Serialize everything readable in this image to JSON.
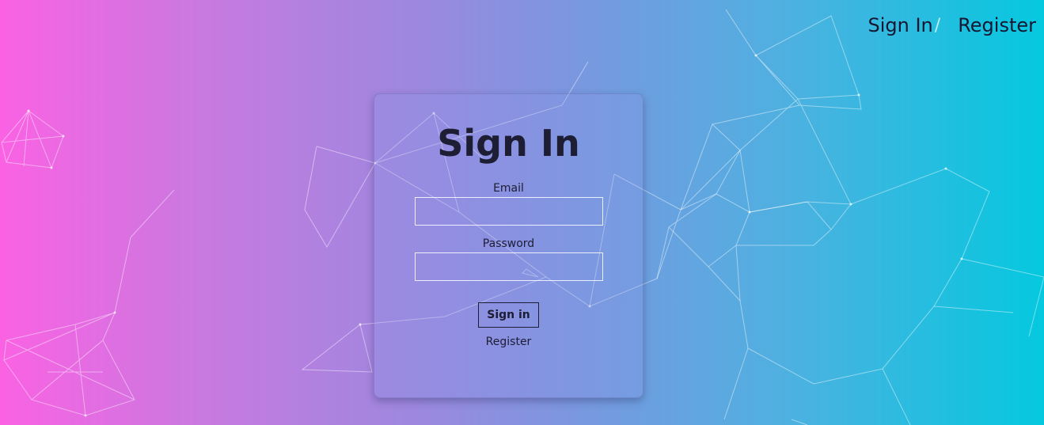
{
  "nav": {
    "sign_in": "Sign In",
    "separator": "/",
    "register": "Register"
  },
  "form": {
    "title": "Sign In",
    "email_label": "Email",
    "email_value": "",
    "password_label": "Password",
    "password_value": "",
    "submit_label": "Sign in",
    "register_link": "Register"
  },
  "colors": {
    "gradient_left": "#fa62e3",
    "gradient_right": "#05c8df",
    "text": "#1d1d33"
  }
}
